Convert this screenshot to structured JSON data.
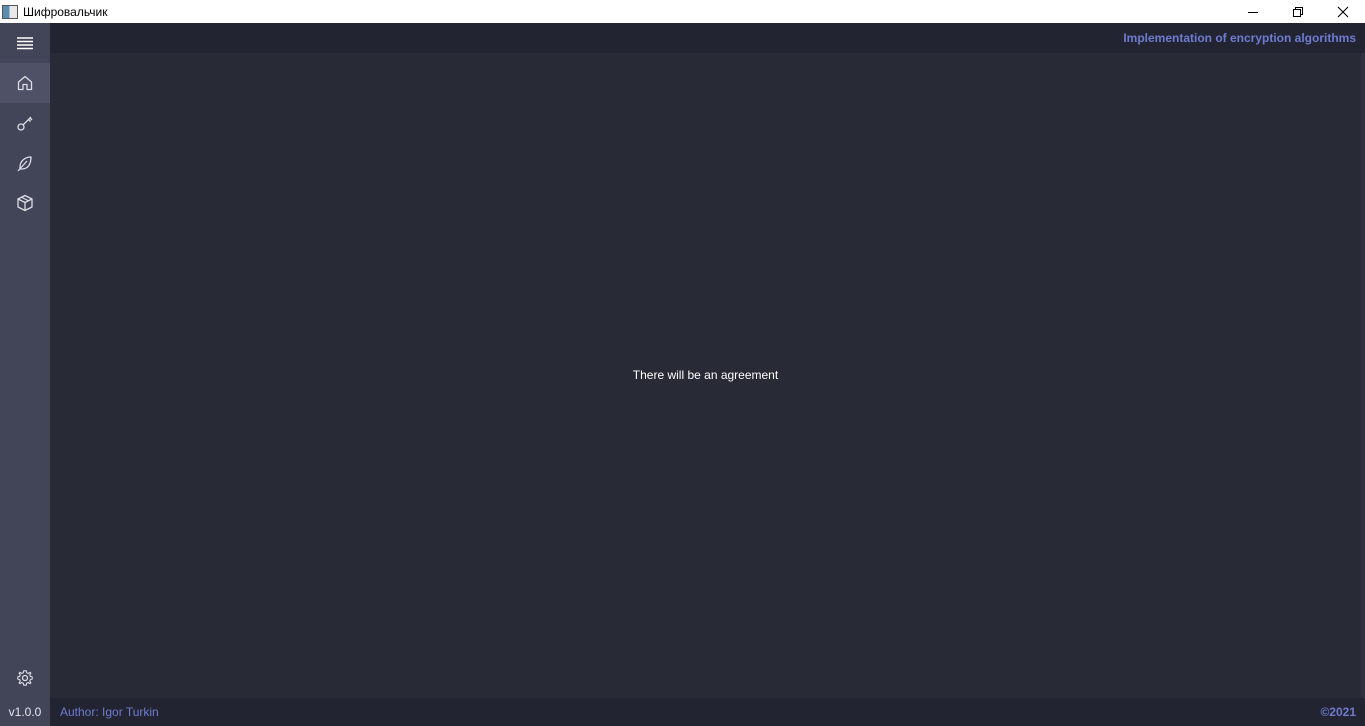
{
  "window": {
    "title": "Шифровальчик"
  },
  "header": {
    "title": "Implementation of encryption algorithms"
  },
  "sidebar": {
    "items": [
      {
        "icon": "menu-icon"
      },
      {
        "icon": "home-icon",
        "active": true
      },
      {
        "icon": "key-icon"
      },
      {
        "icon": "feather-icon"
      },
      {
        "icon": "cube-icon"
      },
      {
        "icon": "gear-icon"
      }
    ]
  },
  "main": {
    "text": "There will be an agreement"
  },
  "footer": {
    "version": "v1.0.0",
    "author": "Author: Igor Turkin",
    "copyright": "©2021"
  },
  "colors": {
    "accent": "#6f7bd0",
    "sidebar_bg": "#424458",
    "content_bg": "#282a36",
    "header_bg": "#222431"
  }
}
